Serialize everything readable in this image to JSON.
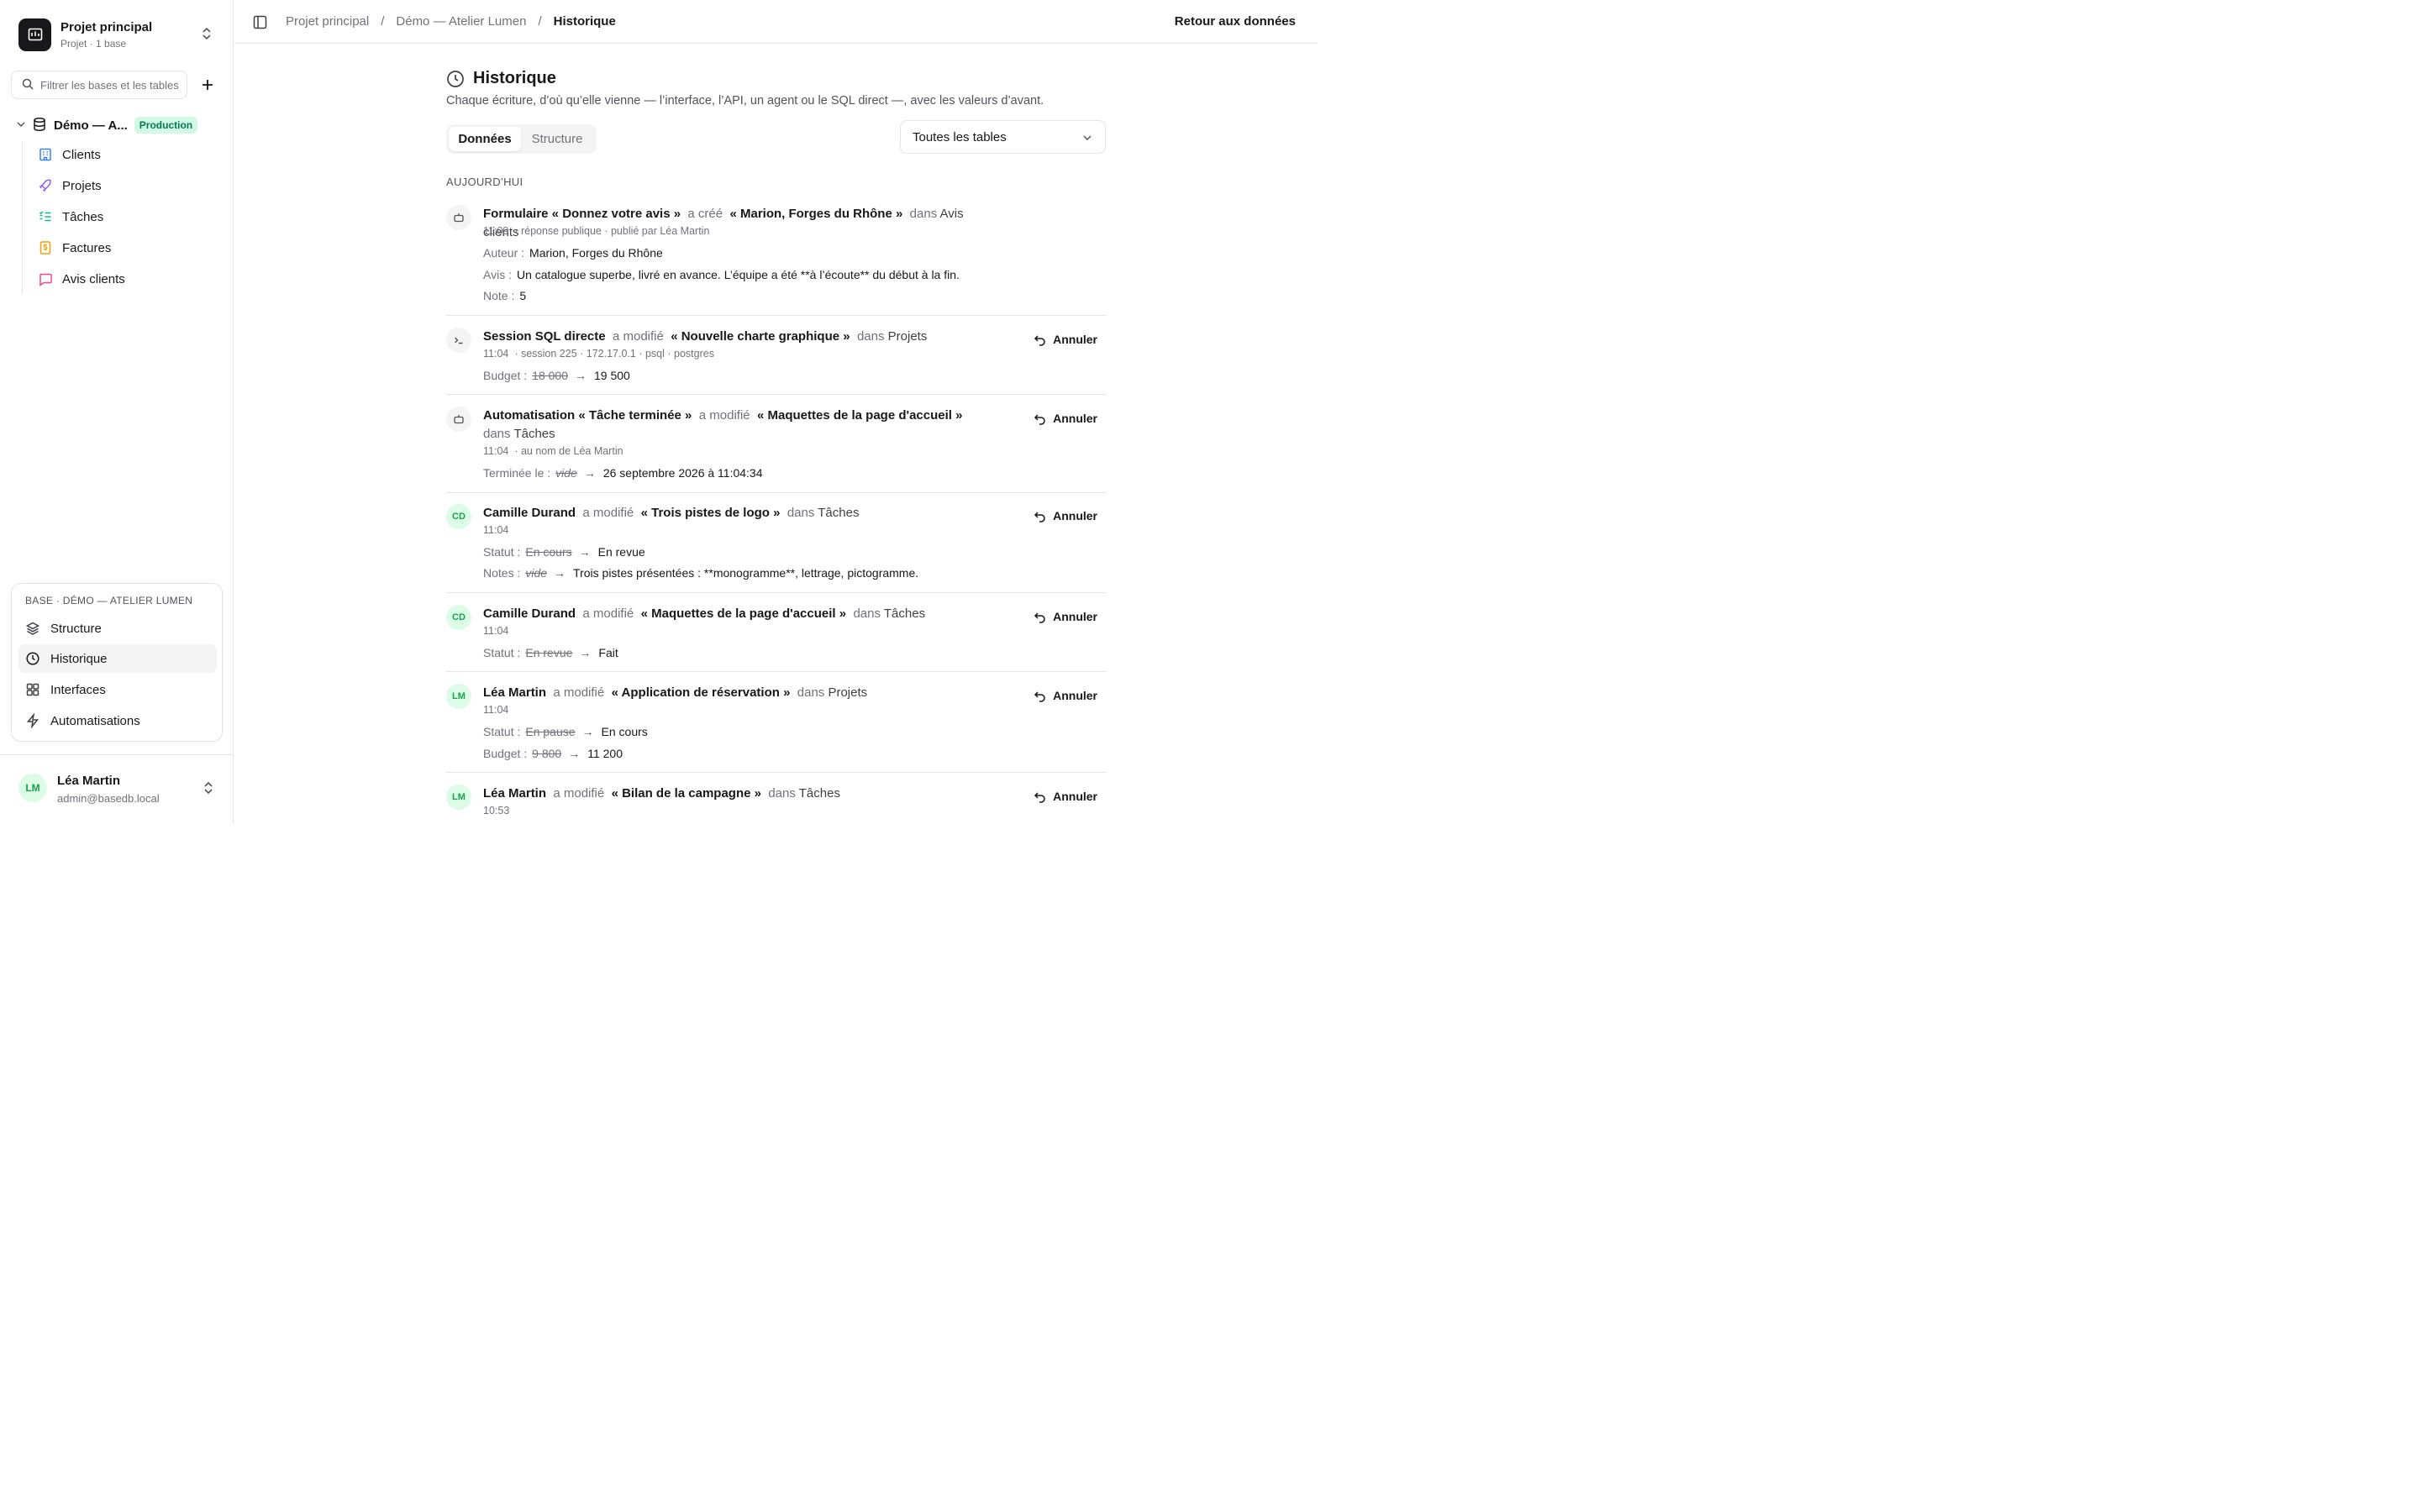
{
  "sidebar": {
    "project": {
      "name": "Projet principal",
      "subtitle": "Projet · 1 base"
    },
    "filter_placeholder": "Filtrer les bases et les tables",
    "database": {
      "name": "Démo — A...",
      "badge": "Production"
    },
    "tables": [
      {
        "label": "Clients",
        "icon": "building-icon",
        "color": "#3b82f6"
      },
      {
        "label": "Projets",
        "icon": "rocket-icon",
        "color": "#8b5cf6"
      },
      {
        "label": "Tâches",
        "icon": "checklist-icon",
        "color": "#10b981"
      },
      {
        "label": "Factures",
        "icon": "dollar-document-icon",
        "color": "#f59e0b"
      },
      {
        "label": "Avis clients",
        "icon": "message-icon",
        "color": "#ec4899"
      }
    ],
    "base_card": {
      "label": "BASE · DÉMO — ATELIER LUMEN",
      "items": [
        {
          "label": "Structure",
          "icon": "layers-icon"
        },
        {
          "label": "Historique",
          "icon": "clock-icon",
          "active": true
        },
        {
          "label": "Interfaces",
          "icon": "grid-icon"
        },
        {
          "label": "Automatisations",
          "icon": "bolt-icon"
        }
      ]
    },
    "user": {
      "initials": "LM",
      "name": "Léa Martin",
      "email": "admin@basedb.local"
    }
  },
  "topbar": {
    "breadcrumbs": [
      "Projet principal",
      "Démo — Atelier Lumen",
      "Historique"
    ],
    "back_label": "Retour aux données"
  },
  "main": {
    "title": "Historique",
    "description": "Chaque écriture, d’où qu’elle vienne — l’interface, l’API, un agent ou le SQL direct —, avec les valeurs d’avant.",
    "tabs": [
      "Données",
      "Structure"
    ],
    "filter_select": "Toutes les tables",
    "section_label": "AUJOURD’HUI",
    "undo_label": "Annuler",
    "entries": [
      {
        "actor": "Formulaire « Donnez votre avis »",
        "verb": "a créé",
        "record": "« Marion, Forges du Rhône »",
        "in": "dans",
        "table": "Avis clients",
        "time": "11:09",
        "meta": "· réponse publique · publié par Léa Martin",
        "fields": [
          {
            "label": "Auteur :",
            "value": "Marion, Forges du Rhône"
          },
          {
            "label": "Avis :",
            "value": "Un catalogue superbe, livré en avance. L’équipe a été **à l’écoute** du début à la fin."
          },
          {
            "label": "Note :",
            "value": "5"
          }
        ]
      },
      {
        "actor": "Session SQL directe",
        "verb": "a modifié",
        "record": "« Nouvelle charte graphique »",
        "in": "dans",
        "table": "Projets",
        "time": "11:04",
        "meta": "· session 225 · 172.17.0.1 · psql · postgres",
        "fields": [
          {
            "label": "Budget :",
            "old": "18 000",
            "new": "19 500"
          }
        ]
      },
      {
        "actor": "Automatisation « Tâche terminée »",
        "verb": "a modifié",
        "record": "« Maquettes de la page d'accueil »",
        "in": "dans",
        "table": "Tâches",
        "time": "11:04",
        "meta": "· au nom de Léa Martin",
        "fields": [
          {
            "label": "Terminée le :",
            "old": "vide",
            "new": "26 septembre 2026 à 11:04:34"
          }
        ]
      },
      {
        "initials": "CD",
        "actor": "Camille Durand",
        "verb": "a modifié",
        "record": "« Trois pistes de logo »",
        "in": "dans",
        "table": "Tâches",
        "time": "11:04",
        "fields": [
          {
            "label": "Statut :",
            "old": "En cours",
            "new": "En revue"
          },
          {
            "label": "Notes :",
            "old": "vide",
            "new": "Trois pistes présentées : **monogramme**, lettrage, pictogramme."
          }
        ]
      },
      {
        "initials": "CD",
        "actor": "Camille Durand",
        "verb": "a modifié",
        "record": "« Maquettes de la page d'accueil »",
        "in": "dans",
        "table": "Tâches",
        "time": "11:04",
        "fields": [
          {
            "label": "Statut :",
            "old": "En revue",
            "new": "Fait"
          }
        ]
      },
      {
        "initials": "LM",
        "actor": "Léa Martin",
        "verb": "a modifié",
        "record": "« Application de réservation »",
        "in": "dans",
        "table": "Projets",
        "time": "11:04",
        "fields": [
          {
            "label": "Statut :",
            "old": "En pause",
            "new": "En cours"
          },
          {
            "label": "Budget :",
            "old": "9 800",
            "new": "11 200"
          }
        ]
      },
      {
        "initials": "LM",
        "actor": "Léa Martin",
        "verb": "a modifié",
        "record": "« Bilan de la campagne »",
        "in": "dans",
        "table": "Tâches",
        "time": "10:53"
      }
    ]
  }
}
